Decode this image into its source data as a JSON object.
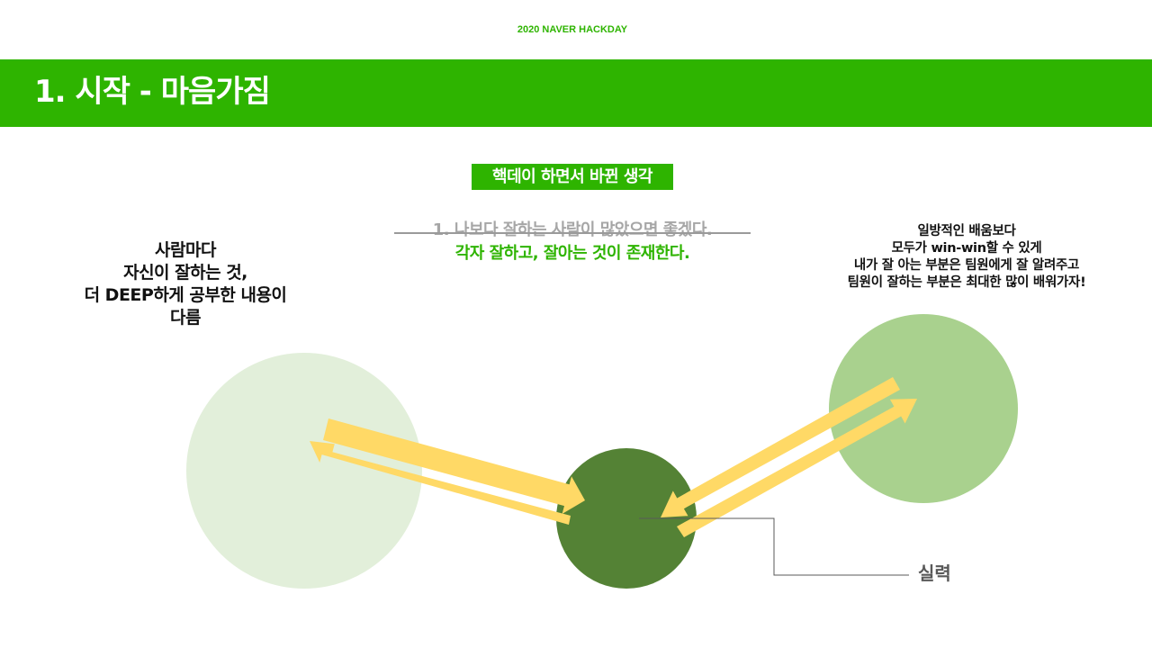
{
  "header": {
    "event_label": "2020 NAVER HACKDAY",
    "title": "1. 시작 - 마음가짐"
  },
  "content": {
    "subtitle": "핵데이 하면서 바뀐 생각",
    "struck_thought": "1.  나보다 잘하는 사람이 많았으면 좋겠다.",
    "new_thought": "각자 잘하고, 잘아는 것이 존재한다.",
    "left_text": [
      "사람마다",
      "자신이 잘하는 것,",
      "더 DEEP하게 공부한 내용이",
      "다름"
    ],
    "right_text": [
      "일방적인 배움보다",
      "모두가 win-win할 수 있게",
      "내가 잘 아는 부분은 팀원에게 잘 알려주고",
      "팀원이 잘하는 부분은 최대한 많이 배워가자!"
    ],
    "skill_label": "실력"
  },
  "colors": {
    "brand_green": "#2eb400",
    "circle_left": "#e2efda",
    "circle_center": "#548235",
    "circle_right": "#a9d18e",
    "arrow": "#ffd966",
    "struck_text": "#a6a6a6",
    "callout_line": "#595959"
  }
}
